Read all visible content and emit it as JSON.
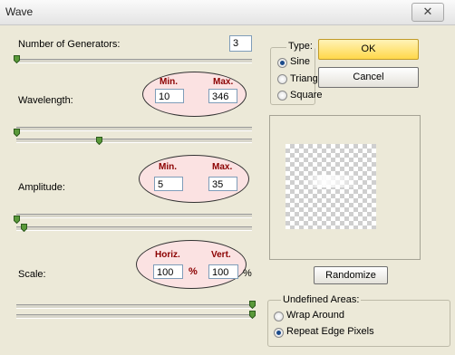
{
  "window": {
    "title": "Wave",
    "close_glyph": "✕"
  },
  "generators": {
    "label": "Number of Generators:",
    "value": "3",
    "slider": 0.0
  },
  "wavelength": {
    "label": "Wavelength:",
    "min_label": "Min.",
    "max_label": "Max.",
    "min": "10",
    "max": "346",
    "min_slider": 0.0,
    "max_slider": 0.35
  },
  "amplitude": {
    "label": "Amplitude:",
    "min_label": "Min.",
    "max_label": "Max.",
    "min": "5",
    "max": "35",
    "min_slider": 0.0,
    "max_slider": 0.03
  },
  "scale": {
    "label": "Scale:",
    "horiz_label": "Horiz.",
    "vert_label": "Vert.",
    "horiz": "100",
    "vert": "100",
    "percent": "%",
    "horiz_slider": 1.0,
    "vert_slider": 1.0
  },
  "type": {
    "title": "Type:",
    "options": [
      "Sine",
      "Triangle",
      "Square"
    ],
    "selected": "Sine"
  },
  "buttons": {
    "ok": "OK",
    "cancel": "Cancel",
    "randomize": "Randomize"
  },
  "undefined_areas": {
    "title": "Undefined Areas:",
    "options": [
      "Wrap Around",
      "Repeat Edge Pixels"
    ],
    "selected": "Repeat Edge Pixels"
  },
  "colors": {
    "oval_fill": "#fbe2e2",
    "ok_button": "#ffe88c",
    "slider_thumb": "#5a9a3a"
  }
}
